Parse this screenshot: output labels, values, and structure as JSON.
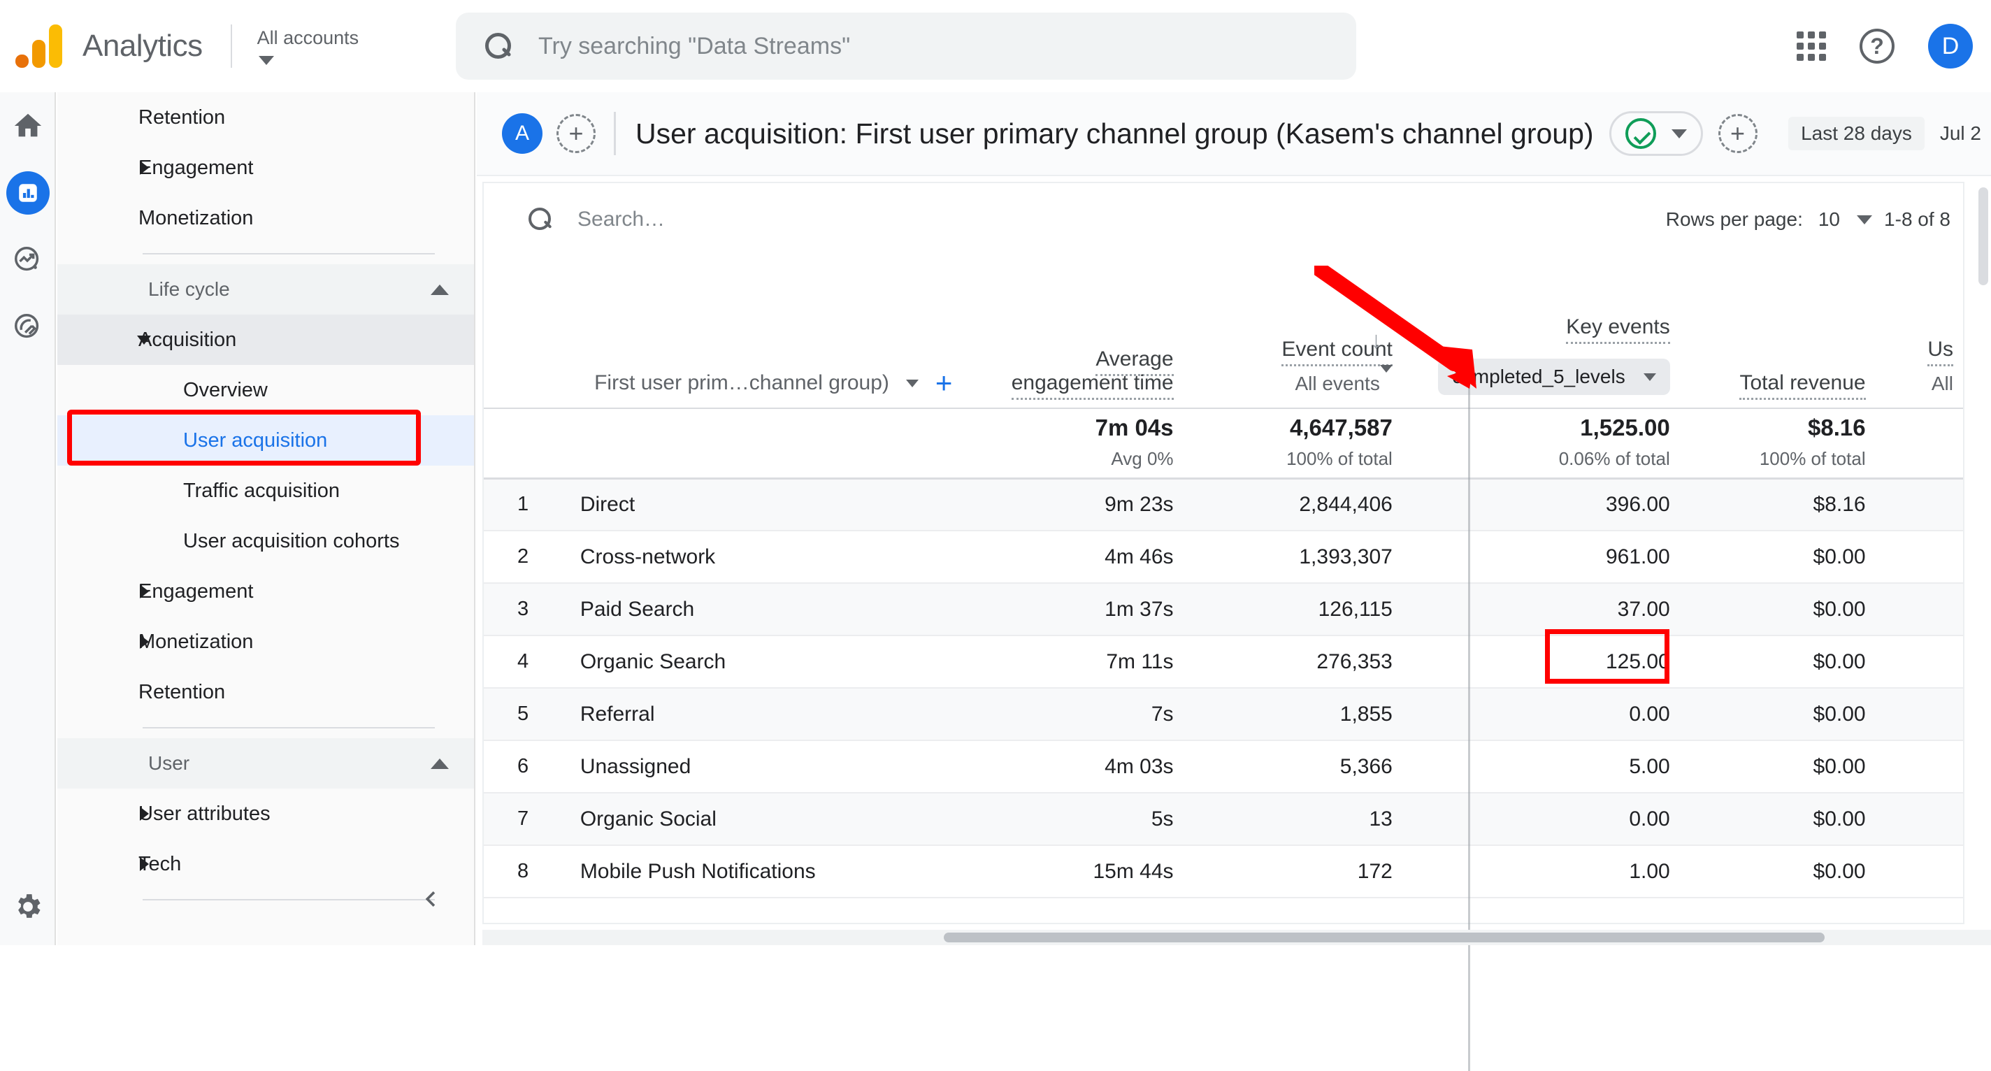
{
  "topbar": {
    "brand": "Analytics",
    "account_label": "All accounts",
    "search_placeholder": "Try searching \"Data Streams\"",
    "avatar_initial": "D",
    "help_glyph": "?"
  },
  "rail": {
    "items": [
      {
        "name": "home",
        "label": "Home"
      },
      {
        "name": "reports",
        "label": "Reports"
      },
      {
        "name": "explore",
        "label": "Explore"
      },
      {
        "name": "advertising",
        "label": "Advertising"
      },
      {
        "name": "admin",
        "label": "Admin"
      }
    ]
  },
  "nav": {
    "items": [
      {
        "label": "Retention",
        "level": "sub",
        "expandable": false,
        "selected": false
      },
      {
        "label": "Engagement",
        "level": "sub",
        "expandable": true,
        "selected": false
      },
      {
        "label": "Monetization",
        "level": "sub",
        "expandable": false,
        "selected": false
      }
    ],
    "sections": [
      {
        "label": "Life cycle",
        "collapsed": false
      },
      {
        "label": "User",
        "collapsed": false
      }
    ],
    "lifecycle_items": [
      {
        "label": "Acquisition",
        "expandable": true,
        "selected_group": true
      },
      {
        "label": "Overview",
        "sub": true
      },
      {
        "label": "User acquisition",
        "sub": true,
        "active": true
      },
      {
        "label": "Traffic acquisition",
        "sub": true
      },
      {
        "label": "User acquisition cohorts",
        "sub": true
      },
      {
        "label": "Engagement",
        "expandable": true
      },
      {
        "label": "Monetization",
        "expandable": true
      },
      {
        "label": "Retention"
      }
    ],
    "user_items": [
      {
        "label": "User attributes",
        "expandable": true
      },
      {
        "label": "Tech",
        "expandable": true
      }
    ]
  },
  "report_header": {
    "badge": "A",
    "add_comparison_glyph": "+",
    "title": "User acquisition: First user primary channel group (Kasem's channel group)",
    "add_glyph": "+",
    "date_chip": "Last 28 days",
    "date_text": "Jul 2"
  },
  "table_controls": {
    "search_placeholder": "Search…",
    "rows_per_page_label": "Rows per page:",
    "rows_per_page_value": "10",
    "range": "1-8 of 8"
  },
  "table": {
    "dimension_header": "First user prim…channel group)",
    "columns": [
      {
        "key": "avg_engagement",
        "label": "Average engagement time",
        "sub": "Avg 0%",
        "sub_header": ""
      },
      {
        "key": "event_count",
        "label": "Event count",
        "sub_header": "All events",
        "sub": "100% of total"
      },
      {
        "key": "key_events",
        "label": "Key events",
        "sub_header": "completed_5_levels",
        "sub": "0.06% of total"
      },
      {
        "key": "total_revenue",
        "label": "Total revenue",
        "sub_header": "",
        "sub": "100% of total"
      },
      {
        "key": "users",
        "label": "Us",
        "sub_header": "All",
        "sub": ""
      }
    ],
    "totals": {
      "avg_engagement": "7m 04s",
      "avg_engagement_sub": "Avg 0%",
      "event_count": "4,647,587",
      "event_count_sub": "100% of total",
      "key_events": "1,525.00",
      "key_events_sub": "0.06% of total",
      "total_revenue": "$8.16",
      "total_revenue_sub": "100% of total"
    },
    "rows": [
      {
        "idx": "1",
        "dim": "Direct",
        "avg_engagement": "9m 23s",
        "event_count": "2,844,406",
        "key_events": "396.00",
        "total_revenue": "$8.16"
      },
      {
        "idx": "2",
        "dim": "Cross-network",
        "avg_engagement": "4m 46s",
        "event_count": "1,393,307",
        "key_events": "961.00",
        "total_revenue": "$0.00"
      },
      {
        "idx": "3",
        "dim": "Paid Search",
        "avg_engagement": "1m 37s",
        "event_count": "126,115",
        "key_events": "37.00",
        "total_revenue": "$0.00"
      },
      {
        "idx": "4",
        "dim": "Organic Search",
        "avg_engagement": "7m 11s",
        "event_count": "276,353",
        "key_events": "125.00",
        "total_revenue": "$0.00"
      },
      {
        "idx": "5",
        "dim": "Referral",
        "avg_engagement": "7s",
        "event_count": "1,855",
        "key_events": "0.00",
        "total_revenue": "$0.00"
      },
      {
        "idx": "6",
        "dim": "Unassigned",
        "avg_engagement": "4m 03s",
        "event_count": "5,366",
        "key_events": "5.00",
        "total_revenue": "$0.00"
      },
      {
        "idx": "7",
        "dim": "Organic Social",
        "avg_engagement": "5s",
        "event_count": "13",
        "key_events": "0.00",
        "total_revenue": "$0.00"
      },
      {
        "idx": "8",
        "dim": "Mobile Push Notifications",
        "avg_engagement": "15m 44s",
        "event_count": "172",
        "key_events": "1.00",
        "total_revenue": "$0.00"
      }
    ]
  },
  "annotations": {
    "highlight_color": "#ff0000",
    "arrow_target": "key-events-metric-dropdown",
    "boxed_nav_item": "User acquisition",
    "boxed_cell_value": "125.00"
  }
}
